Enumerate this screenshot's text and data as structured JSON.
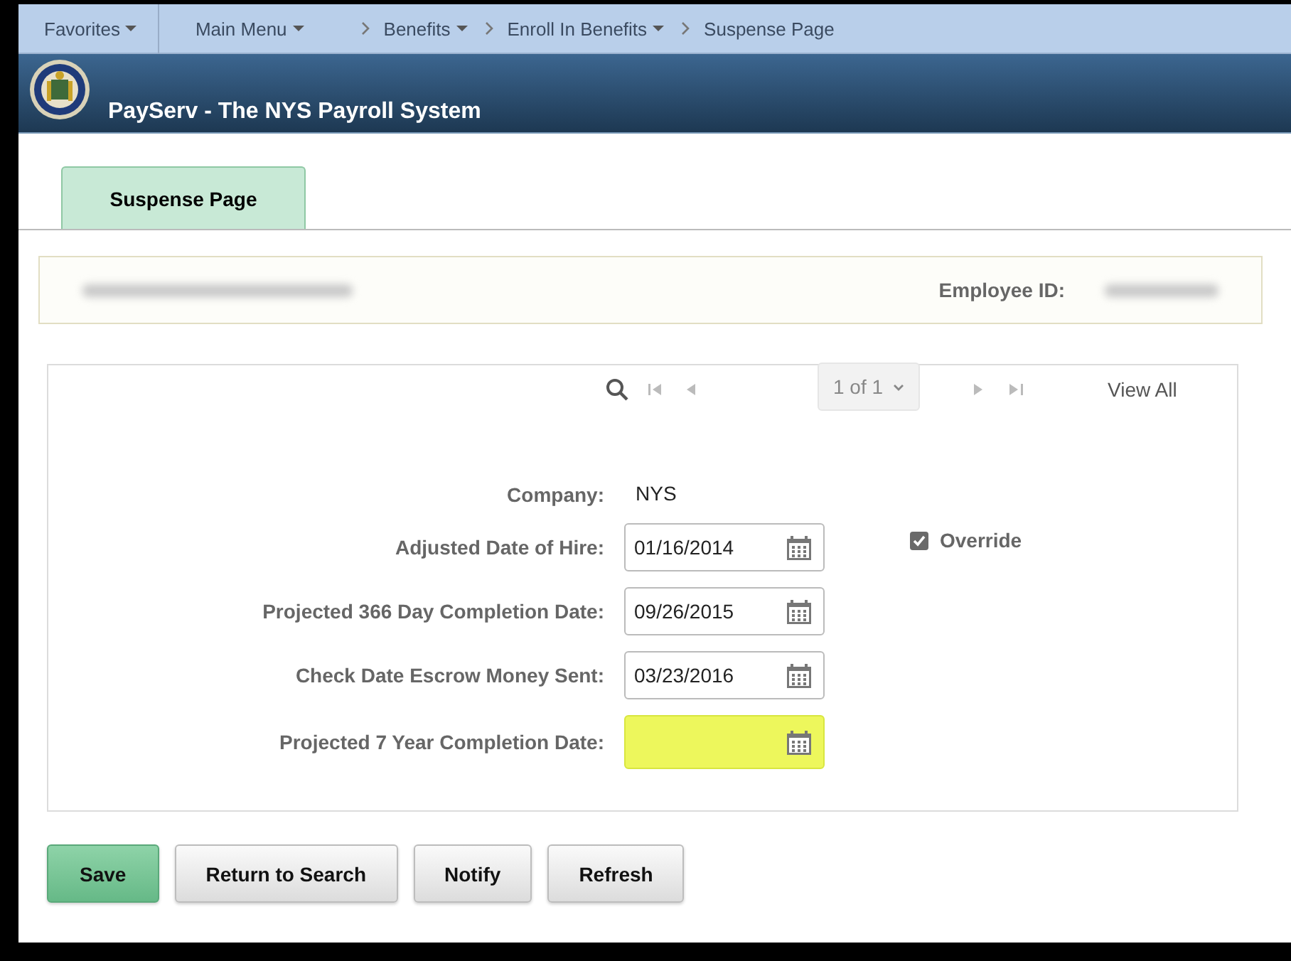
{
  "navbar": {
    "favorites": "Favorites",
    "main_menu": "Main Menu",
    "breadcrumbs": [
      {
        "label": "Benefits",
        "dropdown": true
      },
      {
        "label": "Enroll In Benefits",
        "dropdown": true
      },
      {
        "label": "Suspense Page",
        "dropdown": false
      }
    ]
  },
  "header": {
    "title": "PayServ - The NYS Payroll System"
  },
  "tabs": [
    {
      "label": "Suspense Page",
      "selected": true
    }
  ],
  "employee": {
    "id_label": "Employee ID:"
  },
  "pager": {
    "count": "1 of 1",
    "view_all": "View All"
  },
  "fields": [
    {
      "kind": "text",
      "label": "Company:",
      "value": "NYS"
    },
    {
      "kind": "date",
      "label": "Adjusted Date of Hire:",
      "value": "01/16/2014",
      "highlighted": false
    },
    {
      "kind": "date",
      "label": "Projected 366 Day Completion Date:",
      "value": "09/26/2015",
      "highlighted": false
    },
    {
      "kind": "date",
      "label": "Check Date Escrow Money Sent:",
      "value": "03/23/2016",
      "highlighted": false
    },
    {
      "kind": "date",
      "label": "Projected 7 Year Completion Date:",
      "highlighted": true
    }
  ],
  "override": {
    "label": "Override",
    "checked": true
  },
  "buttons": [
    {
      "label": "Save",
      "primary": true
    },
    {
      "label": "Return to Search",
      "primary": false
    },
    {
      "label": "Notify",
      "primary": false
    },
    {
      "label": "Refresh",
      "primary": false
    }
  ]
}
